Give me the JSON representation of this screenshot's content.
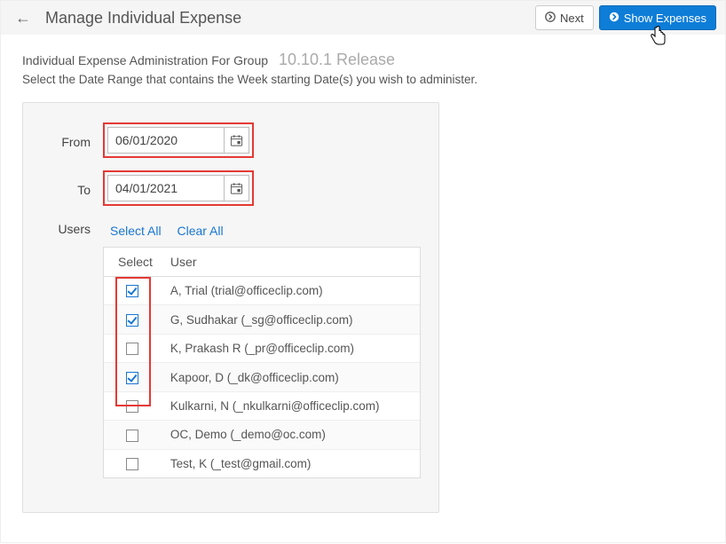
{
  "header": {
    "title": "Manage Individual Expense",
    "next_label": "Next",
    "show_expenses_label": "Show Expenses"
  },
  "intro": {
    "line1_prefix": "Individual Expense Administration For Group",
    "version": "10.10.1 Release",
    "line2": "Select the Date Range that contains the Week starting Date(s) you wish to administer."
  },
  "form": {
    "from_label": "From",
    "to_label": "To",
    "users_label": "Users",
    "from_value": "06/01/2020",
    "to_value": "04/01/2021"
  },
  "user_actions": {
    "select_all": "Select All",
    "clear_all": "Clear All"
  },
  "table": {
    "col_select": "Select",
    "col_user": "User"
  },
  "users": [
    {
      "checked": true,
      "name": "A, Trial (trial@officeclip.com)"
    },
    {
      "checked": true,
      "name": "G, Sudhakar (_sg@officeclip.com)"
    },
    {
      "checked": false,
      "name": "K, Prakash R (_pr@officeclip.com)"
    },
    {
      "checked": true,
      "name": "Kapoor, D (_dk@officeclip.com)"
    },
    {
      "checked": false,
      "name": "Kulkarni, N (_nkulkarni@officeclip.com)"
    },
    {
      "checked": false,
      "name": "OC, Demo (_demo@oc.com)"
    },
    {
      "checked": false,
      "name": "Test, K (_test@gmail.com)"
    }
  ]
}
